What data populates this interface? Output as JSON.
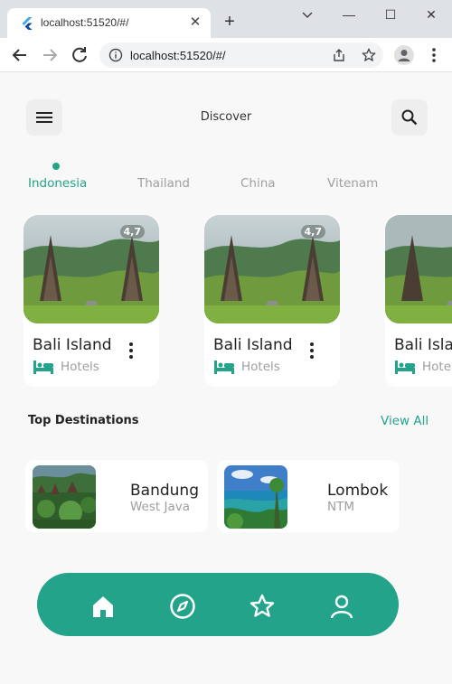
{
  "browser": {
    "tab_title": "localhost:51520/#/",
    "tab_close": "✕",
    "new_tab": "+",
    "url": "localhost:51520/#/",
    "minimize": "—",
    "maximize": "☐",
    "close": "✕"
  },
  "app": {
    "title": "Discover",
    "categories": [
      "Indonesia",
      "Thailand",
      "China",
      "Vitenam"
    ],
    "active_category": "Indonesia",
    "cards": [
      {
        "rating": "4,7",
        "name": "Bali Island",
        "type": "Hotels"
      },
      {
        "rating": "4,7",
        "name": "Bali Island",
        "type": "Hotels"
      },
      {
        "name": "Bali Isla",
        "type": "Hotels"
      }
    ],
    "section_title": "Top Destinations",
    "view_all": "View All",
    "destinations": [
      {
        "name": "Bandung",
        "region": "West Java"
      },
      {
        "name": "Lombok",
        "region": "NTM"
      }
    ],
    "nav": [
      "home-icon",
      "compass-icon",
      "star-icon",
      "profile-icon"
    ]
  },
  "colors": {
    "accent": "#22a38a",
    "background": "#f8f8f8",
    "muted_text": "#9e9e9e"
  }
}
